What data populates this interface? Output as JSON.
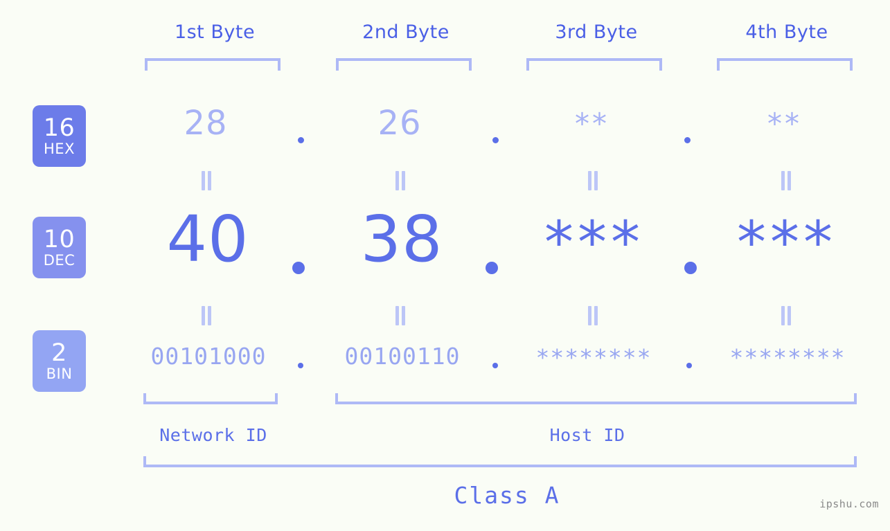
{
  "page": {
    "background_color": "#fafdf6",
    "accent_strong": "#5b6fe8",
    "accent_mid": "#98a6f1",
    "accent_light": "#aeb9f6",
    "label_color": "#4a5fe6"
  },
  "header": {
    "byte_labels": [
      {
        "label": "1st Byte"
      },
      {
        "label": "2nd Byte"
      },
      {
        "label": "3rd Byte"
      },
      {
        "label": "4th Byte"
      }
    ]
  },
  "bases": [
    {
      "number": "16",
      "name": "HEX",
      "color": "#6c7ce9"
    },
    {
      "number": "10",
      "name": "DEC",
      "color": "#8591ee"
    },
    {
      "number": "2",
      "name": "BIN",
      "color": "#93a5f3"
    }
  ],
  "rows": {
    "hex": {
      "values": [
        "28",
        "26",
        "**",
        "**"
      ]
    },
    "dec": {
      "values": [
        "40",
        "38",
        "***",
        "***"
      ]
    },
    "bin": {
      "values": [
        "00101000",
        "00100110",
        "********",
        "********"
      ]
    }
  },
  "separators": {
    "dot": ".",
    "equals": "="
  },
  "footer": {
    "network_id_label": "Network ID",
    "host_id_label": "Host ID",
    "class_label": "Class A",
    "watermark": "ipshu.com"
  }
}
